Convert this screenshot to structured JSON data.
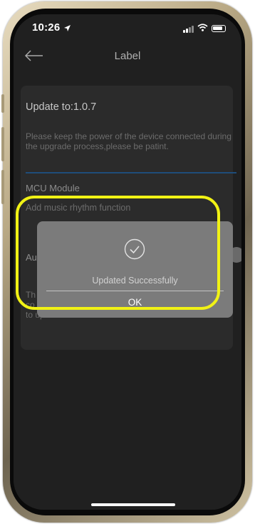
{
  "status_bar": {
    "time": "10:26"
  },
  "nav": {
    "title": "Label"
  },
  "update": {
    "title": "Update to:1.0.7",
    "description": "Please keep the power of the device connected during the upgrade process,please be patint.",
    "module_title": "MCU Module",
    "module_description": "Add music rhythm function",
    "auto_label_partial": "Au",
    "auto_description_partial": "Th\nco\nto update."
  },
  "dialog": {
    "message": "Updated Successfully",
    "ok_label": "OK",
    "icon": "check-circle-icon"
  },
  "colors": {
    "screen_background": "#1d1d1d",
    "card_background": "#2b2b2b",
    "dialog_background": "#7b7b7b",
    "highlight": "#f1f215",
    "progress_line": "#1f4d7a"
  }
}
